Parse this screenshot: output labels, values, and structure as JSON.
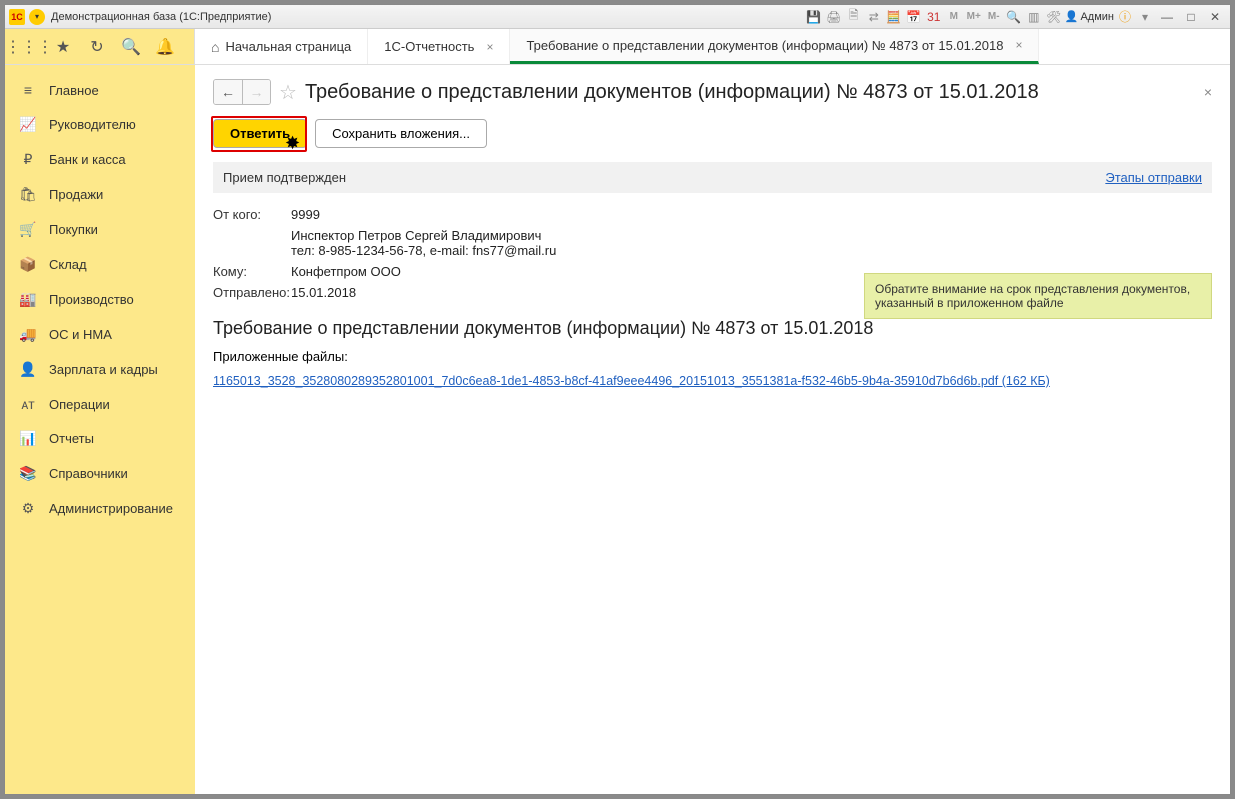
{
  "window": {
    "title": "Демонстрационная база  (1С:Предприятие)",
    "admin_label": "Админ"
  },
  "sidebar": {
    "items": [
      {
        "icon": "≡",
        "label": "Главное"
      },
      {
        "icon": "📈",
        "label": "Руководителю"
      },
      {
        "icon": "₽",
        "label": "Банк и касса"
      },
      {
        "icon": "🛍",
        "label": "Продажи"
      },
      {
        "icon": "🛒",
        "label": "Покупки"
      },
      {
        "icon": "📦",
        "label": "Склад"
      },
      {
        "icon": "🏭",
        "label": "Производство"
      },
      {
        "icon": "🚚",
        "label": "ОС и НМА"
      },
      {
        "icon": "👤",
        "label": "Зарплата и кадры"
      },
      {
        "icon": "ᴀᴛ",
        "label": "Операции"
      },
      {
        "icon": "📊",
        "label": "Отчеты"
      },
      {
        "icon": "📚",
        "label": "Справочники"
      },
      {
        "icon": "⚙",
        "label": "Администрирование"
      }
    ]
  },
  "tabs": {
    "items": [
      {
        "label": "Начальная страница",
        "home": true
      },
      {
        "label": "1С-Отчетность",
        "closable": true
      },
      {
        "label": "Требование о представлении документов (информации) № 4873 от 15.01.2018",
        "closable": true,
        "active": true
      }
    ]
  },
  "page": {
    "title": "Требование о представлении документов (информации)  № 4873 от 15.01.2018",
    "reply_btn": "Ответить",
    "save_attachments_btn": "Сохранить вложения...",
    "status_text": "Прием подтвержден",
    "stages_link": "Этапы отправки",
    "from_label": "От кого:",
    "from_value": "9999",
    "inspector_line": "Инспектор Петров Сергей Владимирович",
    "contact_line": "тел: 8-985-1234-56-78, e-mail: fns77@mail.ru",
    "to_label": "Кому:",
    "to_value": "Конфетпром ООО",
    "sent_label": "Отправлено:",
    "sent_value": "15.01.2018",
    "notice_text": "Обратите внимание на срок представления документов, указанный в приложенном файле",
    "subtitle": "Требование о представлении документов (информации) № 4873 от 15.01.2018",
    "attachments_label": "Приложенные файлы:",
    "file_link": "1165013_3528_3528080289352801001_7d0c6ea8-1de1-4853-b8cf-41af9eee4496_20151013_3551381a-f532-46b5-9b4a-35910d7b6d6b.pdf (162 КБ)"
  }
}
